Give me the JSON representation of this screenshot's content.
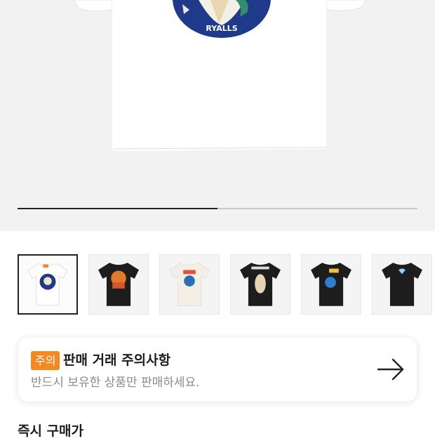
{
  "product_images": {
    "total": 6,
    "current_index": 1,
    "progress_fraction": 0.5,
    "thumbnails": [
      {
        "label": "white tee navy logo",
        "color": "#ffffff",
        "selected": true
      },
      {
        "label": "black tee orange graphic",
        "color": "#1d1d1d",
        "selected": false
      },
      {
        "label": "cream tee duck graphic",
        "color": "#f4efe6",
        "selected": false
      },
      {
        "label": "black tee bear graphic",
        "color": "#1d1d1d",
        "selected": false
      },
      {
        "label": "black tee duck graphic",
        "color": "#1d1d1d",
        "selected": false
      },
      {
        "label": "black tee heart logo",
        "color": "#1d1d1d",
        "selected": false
      }
    ]
  },
  "notice": {
    "badge": "주의",
    "title": "판매 거래 주의사항",
    "subtitle": "반드시 보유한 상품만 판매하세요."
  },
  "section": {
    "title": "즉시 구매가"
  },
  "colors": {
    "badge": "#f28a21",
    "logo_navy": "#1f3a8a",
    "hero_bg": "#f2f2f2"
  }
}
